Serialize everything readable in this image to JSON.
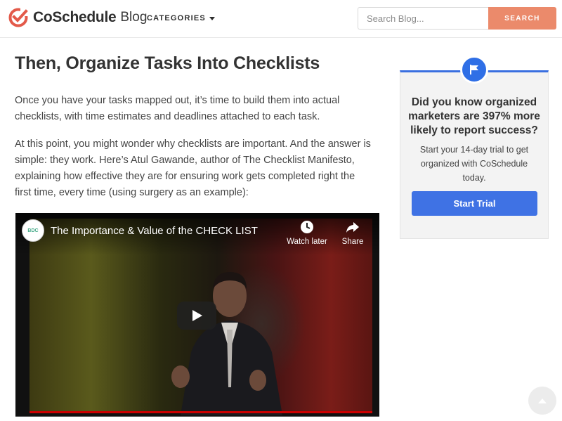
{
  "header": {
    "brand": "CoSchedule",
    "brand_suffix": "Blog",
    "categories_label": "CATEGORIES",
    "search_placeholder": "Search Blog...",
    "search_button": "SEARCH"
  },
  "article": {
    "title": "Then, Organize Tasks Into Checklists",
    "paragraphs": [
      "Once you have your tasks mapped out, it’s time to build them into actual checklists, with time estimates and deadlines attached to each task.",
      "At this point, you might wonder why checklists are important. And the answer is simple: they work. Here’s Atul Gawande, author of The Checklist Manifesto, explaining how effective they are for ensuring work gets completed right the first time, every time (using surgery as an example):"
    ]
  },
  "video": {
    "title": "The Importance & Value of the CHECK LIST",
    "channel_badge": "BDC",
    "watch_later": "Watch later",
    "share": "Share"
  },
  "sidebar": {
    "heading": "Did you know organized marketers are 397% more likely to report success?",
    "text": "Start your 14-day trial to get organized with CoSchedule today.",
    "button": "Start Trial"
  },
  "colors": {
    "brand_orange": "#eb8a6b",
    "accent_blue": "#3f72e4",
    "logo_red": "#e35a4a"
  },
  "icons": [
    "coschedule-logo-icon",
    "caret-down-icon",
    "flag-icon",
    "clock-icon",
    "share-arrow-icon",
    "play-icon",
    "arrow-up-icon"
  ]
}
